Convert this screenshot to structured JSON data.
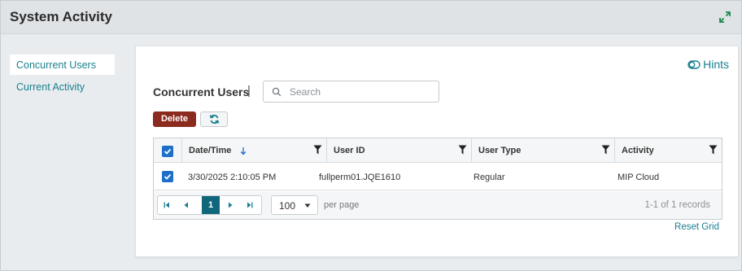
{
  "window": {
    "title": "System Activity"
  },
  "sidebar": {
    "items": [
      {
        "label": "Concurrent Users",
        "active": true
      },
      {
        "label": "Current Activity",
        "active": false
      }
    ]
  },
  "main": {
    "hints_label": "Hints",
    "grid_title": "Concurrent Users",
    "grid_separator": "|",
    "search": {
      "placeholder": "Search",
      "value": ""
    },
    "toolbar": {
      "delete_label": "Delete",
      "refresh_icon": "refresh-icon"
    },
    "columns": [
      {
        "label": "Date/Time",
        "sort": "descending-arrow"
      },
      {
        "label": "User ID"
      },
      {
        "label": "User Type"
      },
      {
        "label": "Activity"
      }
    ],
    "rows": [
      {
        "checked": true,
        "datetime": "3/30/2025 2:10:05 PM",
        "user_id": "fullperm01.JQE1610",
        "user_type": "Regular",
        "activity": "MIP Cloud"
      }
    ],
    "pager": {
      "current_page": "1",
      "page_size": "100",
      "per_page_label": "per page",
      "records_label": "1-1 of 1 records"
    },
    "reset_grid_label": "Reset Grid"
  },
  "colors": {
    "accent": "#1a7f8e",
    "delete": "#8b2a1f",
    "checkbox": "#1e6fc9",
    "current_page": "#10667a"
  }
}
